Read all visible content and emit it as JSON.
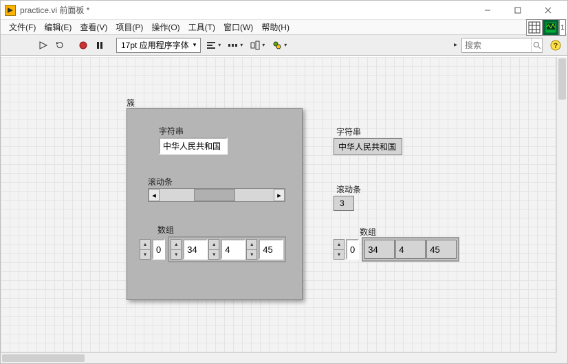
{
  "window": {
    "title": "practice.vi 前面板 *"
  },
  "menu": {
    "file": "文件(F)",
    "edit": "编辑(E)",
    "view": "查看(V)",
    "project": "项目(P)",
    "operate": "操作(O)",
    "tools": "工具(T)",
    "window": "窗口(W)",
    "help": "帮助(H)"
  },
  "toolbar": {
    "font": "17pt 应用程序字体",
    "search_placeholder": "搜索"
  },
  "cluster": {
    "label": "簇",
    "string": {
      "label": "字符串",
      "value": "中华人民共和国"
    },
    "slider": {
      "label": "滚动条"
    },
    "array": {
      "label": "数组",
      "index": "0",
      "values": [
        "34",
        "4",
        "45"
      ]
    }
  },
  "indicators": {
    "string": {
      "label": "字符串",
      "value": "中华人民共和国"
    },
    "slider": {
      "label": "滚动条",
      "value": "3"
    },
    "array": {
      "label": "数组",
      "index": "0",
      "values": [
        "34",
        "4",
        "45"
      ]
    }
  }
}
